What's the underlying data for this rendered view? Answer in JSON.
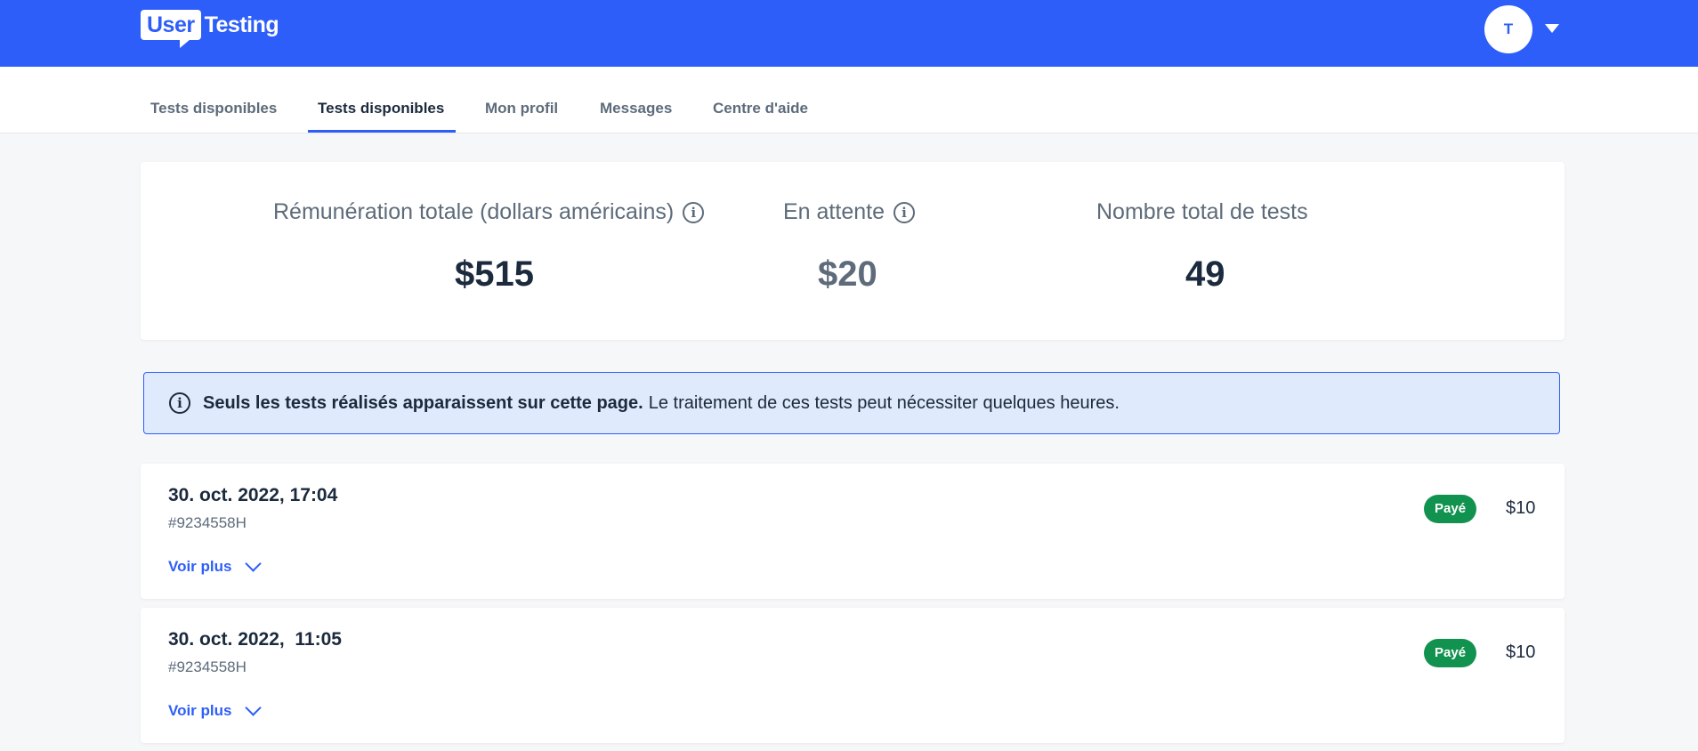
{
  "header": {
    "logo_user": "User",
    "logo_testing": "Testing",
    "avatar_initial": "T",
    "brand_color": "#2e5ef9"
  },
  "nav": {
    "tabs": [
      {
        "label": "Tests disponibles",
        "active": false
      },
      {
        "label": "Tests disponibles",
        "active": true
      },
      {
        "label": "Mon profil",
        "active": false
      },
      {
        "label": "Messages",
        "active": false
      },
      {
        "label": "Centre d'aide",
        "active": false
      }
    ]
  },
  "stats": {
    "total_label": "Rémunération totale (dollars américains)",
    "total_value": "$515",
    "pending_label": "En attente",
    "pending_value": "$20",
    "count_label": "Nombre total de tests",
    "count_value": "49"
  },
  "notice": {
    "icon": "info-icon",
    "bold": "Seuls les tests réalisés apparaissent sur cette page.",
    "text": "Le traitement de ces tests peut nécessiter quelques heures."
  },
  "tests": [
    {
      "date": "30. oct. 2022, 17:04",
      "id": "#9234558H",
      "status": "Payé",
      "amount": "$10",
      "more_label": "Voir plus"
    },
    {
      "date": "30. oct. 2022,  11:05",
      "id": "#9234558H",
      "status": "Payé",
      "amount": "$10",
      "more_label": "Voir plus"
    }
  ],
  "colors": {
    "paid_badge": "#12924f",
    "notice_bg": "#dfeafc",
    "page_bg": "#f6f7f9"
  }
}
